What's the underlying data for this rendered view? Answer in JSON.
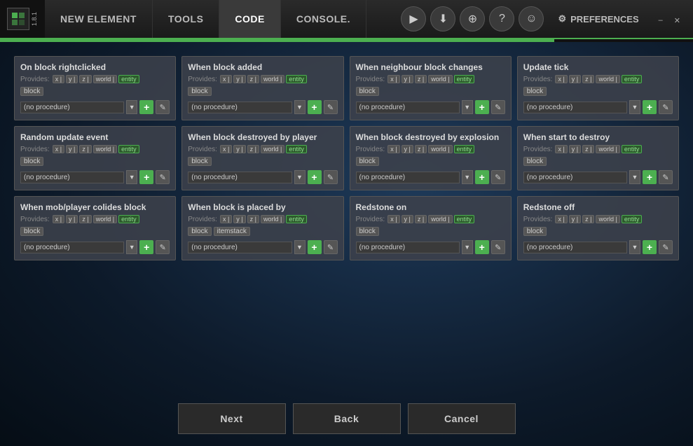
{
  "window": {
    "title": "MCreator",
    "version": "1.8.1",
    "minimize": "–",
    "close": "✕"
  },
  "nav": {
    "tabs": [
      {
        "label": "NEW ELEMENT",
        "active": false
      },
      {
        "label": "TOOLS",
        "active": false
      },
      {
        "label": "CODE",
        "active": true
      },
      {
        "label": "CONSOLE.",
        "active": false
      }
    ]
  },
  "toolbar_icons": [
    {
      "name": "play-icon",
      "symbol": "▶"
    },
    {
      "name": "download-icon",
      "symbol": "⬇"
    },
    {
      "name": "globe-icon",
      "symbol": "🌐"
    },
    {
      "name": "help-icon",
      "symbol": "?"
    },
    {
      "name": "user-icon",
      "symbol": "👤"
    }
  ],
  "preferences_label": "PREFERENCES",
  "progress": 80,
  "cards": [
    {
      "title": "On block rightclicked",
      "provides": [
        "x",
        "y",
        "z",
        "world",
        "entity"
      ],
      "extra_tags": [
        "block"
      ],
      "procedure": "(no procedure)"
    },
    {
      "title": "When block added",
      "provides": [
        "x",
        "y",
        "z",
        "world",
        "entity"
      ],
      "extra_tags": [
        "block"
      ],
      "procedure": "(no procedure)"
    },
    {
      "title": "When neighbour block changes",
      "provides": [
        "x",
        "y",
        "z",
        "world",
        "entity"
      ],
      "extra_tags": [
        "block"
      ],
      "procedure": "(no procedure)"
    },
    {
      "title": "Update tick",
      "provides": [
        "x",
        "y",
        "z",
        "world",
        "entity"
      ],
      "extra_tags": [
        "block"
      ],
      "procedure": "(no procedure)"
    },
    {
      "title": "Random update event",
      "provides": [
        "x",
        "y",
        "z",
        "world",
        "entity"
      ],
      "extra_tags": [
        "block"
      ],
      "procedure": "(no procedure)"
    },
    {
      "title": "When block destroyed by player",
      "provides": [
        "x",
        "y",
        "z",
        "world",
        "entity"
      ],
      "extra_tags": [
        "block"
      ],
      "procedure": "(no procedure)"
    },
    {
      "title": "When block destroyed by explosion",
      "provides": [
        "x",
        "y",
        "z",
        "world",
        "entity"
      ],
      "extra_tags": [
        "block"
      ],
      "procedure": "(no procedure)"
    },
    {
      "title": "When start to destroy",
      "provides": [
        "x",
        "y",
        "z",
        "world",
        "entity"
      ],
      "extra_tags": [
        "block"
      ],
      "procedure": "(no procedure)"
    },
    {
      "title": "When mob/player colides block",
      "provides": [
        "x",
        "y",
        "z",
        "world",
        "entity"
      ],
      "extra_tags": [
        "block"
      ],
      "procedure": "(no procedure)"
    },
    {
      "title": "When block is placed by",
      "provides": [
        "x",
        "y",
        "z",
        "world",
        "entity"
      ],
      "extra_tags": [
        "block",
        "itemstack"
      ],
      "procedure": "(no procedure)"
    },
    {
      "title": "Redstone on",
      "provides": [
        "x",
        "y",
        "z",
        "world",
        "entity"
      ],
      "extra_tags": [
        "block"
      ],
      "procedure": "(no procedure)"
    },
    {
      "title": "Redstone off",
      "provides": [
        "x",
        "y",
        "z",
        "world",
        "entity"
      ],
      "extra_tags": [
        "block"
      ],
      "procedure": "(no procedure)"
    }
  ],
  "provides_label": "Provides:",
  "footer": {
    "next": "Next",
    "back": "Back",
    "cancel": "Cancel"
  }
}
